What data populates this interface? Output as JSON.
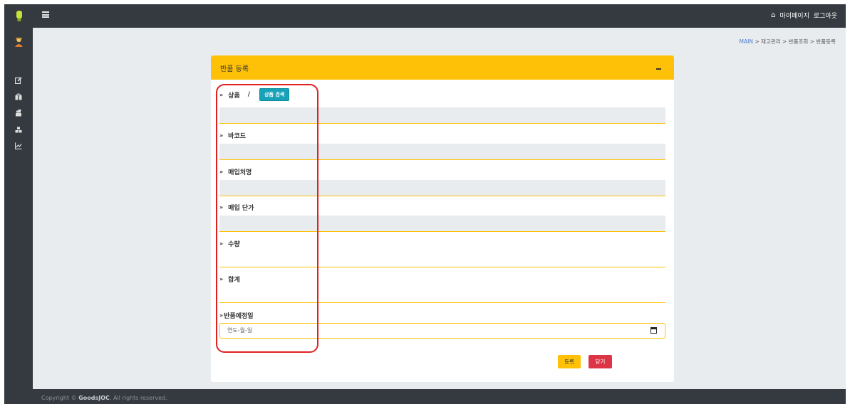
{
  "topbar": {
    "mypage_label": "마이페이지",
    "logout_label": "로그아웃"
  },
  "breadcrumb": {
    "home": "MAIN",
    "sep": " > ",
    "items": [
      "재고관리",
      "반품조회",
      "반품등록"
    ]
  },
  "card": {
    "title": "반품 등록"
  },
  "form": {
    "product": {
      "label": "상품",
      "slash": "/",
      "search_button": "상품 검색",
      "value": ""
    },
    "barcode": {
      "label": "바코드",
      "value": ""
    },
    "vendor": {
      "label": "매입처명",
      "value": ""
    },
    "unit_price": {
      "label": "매입 단가",
      "value": ""
    },
    "quantity": {
      "label": "수량"
    },
    "total": {
      "label": "합계"
    },
    "return_date": {
      "label": "반품예정일",
      "placeholder": "연도-월-일"
    }
  },
  "buttons": {
    "register": "등록",
    "close": "닫기"
  },
  "footer": {
    "prefix": "Copyright © ",
    "brand": "GoodsJOC",
    "suffix": ". All rights reserved."
  },
  "colors": {
    "accent": "#ffc107",
    "danger": "#dc3545",
    "info": "#17a2b8",
    "dark": "#343a40",
    "highlight": "#e02020"
  },
  "icons": [
    "lightbulb-icon",
    "menu-icon",
    "home-icon",
    "user-avatar-icon",
    "edit-icon",
    "gift-icon",
    "inventory-icon",
    "warehouse-icon",
    "chart-icon",
    "calendar-icon"
  ]
}
